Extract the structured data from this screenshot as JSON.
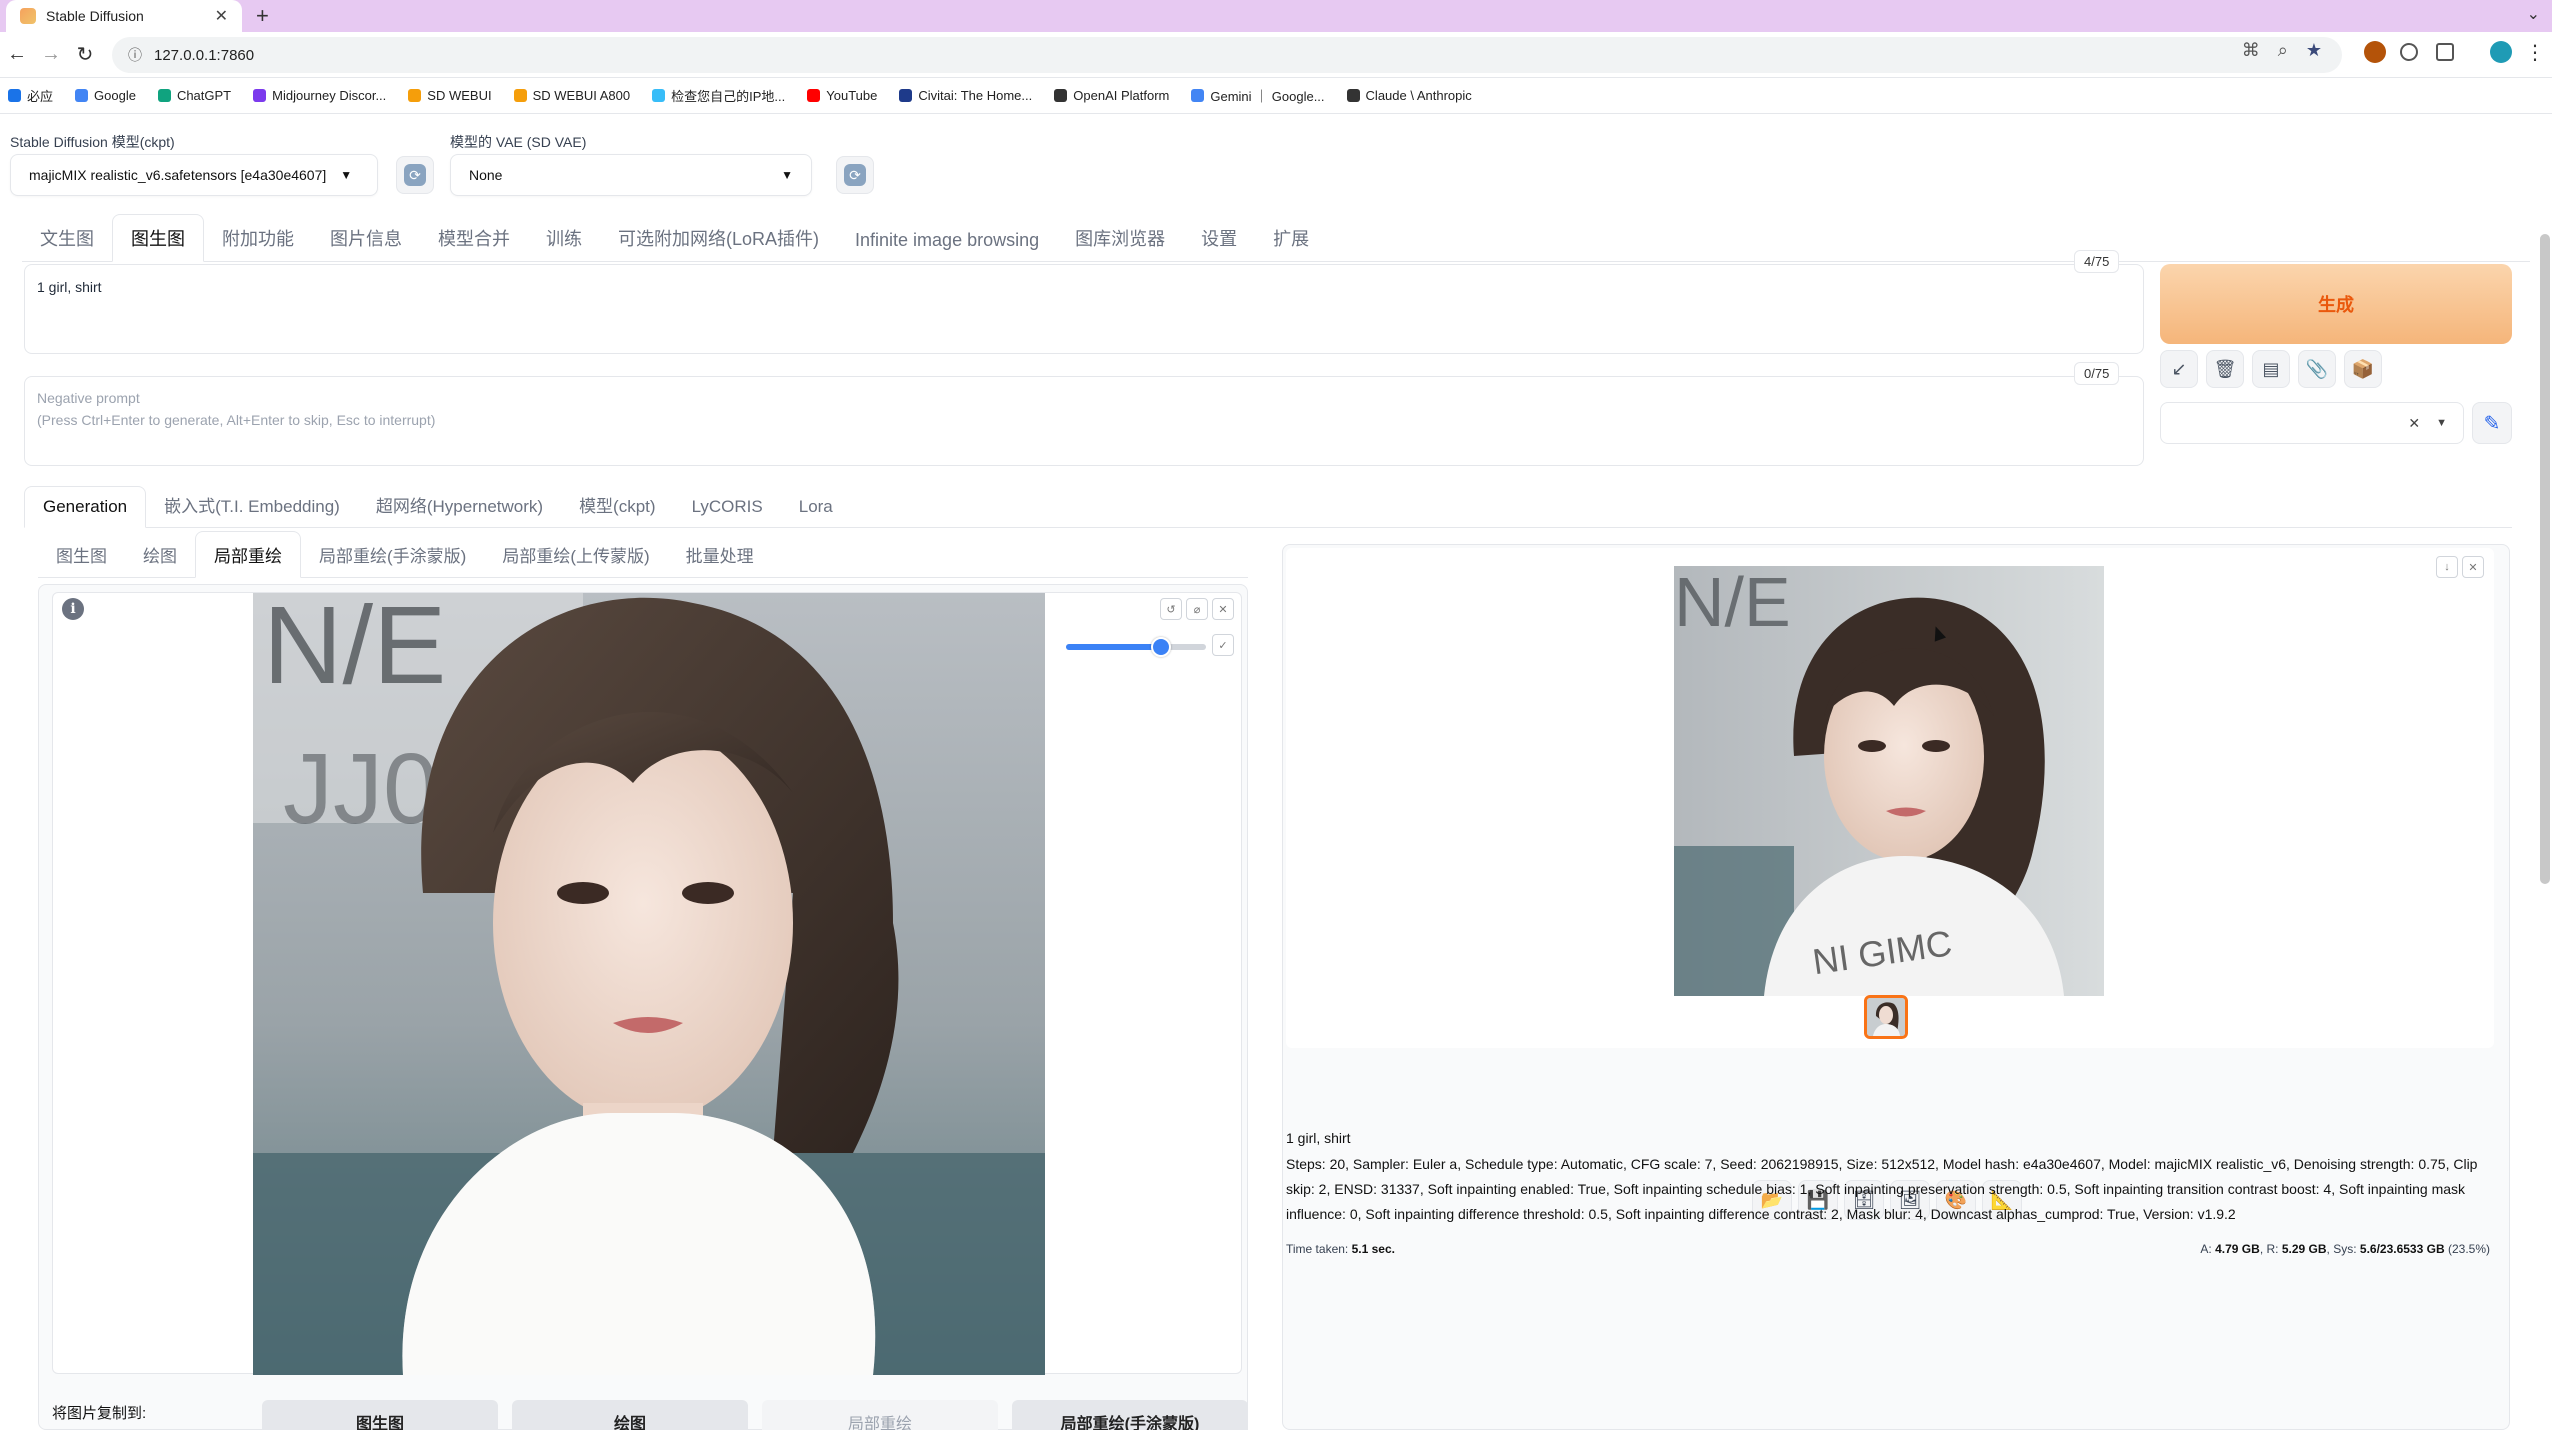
{
  "browser": {
    "tab_title": "Stable Diffusion",
    "tab_close": "✕",
    "new_tab": "+",
    "url": "127.0.0.1:7860",
    "bookmarks": [
      {
        "label": "必应",
        "color": "#1a73e8"
      },
      {
        "label": "Google",
        "color": "#4285f4"
      },
      {
        "label": "ChatGPT",
        "color": "#10a37f"
      },
      {
        "label": "Midjourney Discor...",
        "color": "#7c3aed"
      },
      {
        "label": "SD WEBUI",
        "color": "#f59e0b"
      },
      {
        "label": "SD WEBUI A800",
        "color": "#f59e0b"
      },
      {
        "label": "检查您自己的IP地...",
        "color": "#38bdf8"
      },
      {
        "label": "YouTube",
        "color": "#ff0000"
      },
      {
        "label": "Civitai: The Home...",
        "color": "#1e3a8a"
      },
      {
        "label": "OpenAI Platform",
        "color": "#333333"
      },
      {
        "label": "Gemini ｜ Google...",
        "color": "#4285f4"
      },
      {
        "label": "Claude \\ Anthropic",
        "color": "#333333"
      }
    ]
  },
  "model": {
    "ckpt_label": "Stable Diffusion 模型(ckpt)",
    "ckpt_value": "majicMIX realistic_v6.safetensors [e4a30e4607]",
    "vae_label": "模型的 VAE (SD VAE)",
    "vae_value": "None"
  },
  "main_tabs": [
    "文生图",
    "图生图",
    "附加功能",
    "图片信息",
    "模型合并",
    "训练",
    "可选附加网络(LoRA插件)",
    "Infinite image browsing",
    "图库浏览器",
    "设置",
    "扩展"
  ],
  "prompt": {
    "positive": "1 girl, shirt",
    "positive_counter": "4/75",
    "negative_placeholder_1": "Negative prompt",
    "negative_placeholder_2": "(Press Ctrl+Enter to generate, Alt+Enter to skip, Esc to interrupt)",
    "negative_counter": "0/75"
  },
  "generate_label": "生成",
  "network_tabs": [
    "Generation",
    "嵌入式(T.I. Embedding)",
    "超网络(Hypernetwork)",
    "模型(ckpt)",
    "LyCORIS",
    "Lora"
  ],
  "mode_tabs": [
    "图生图",
    "绘图",
    "局部重绘",
    "局部重绘(手涂蒙版)",
    "局部重绘(上传蒙版)",
    "批量处理"
  ],
  "brush_size_fraction": 0.68,
  "copy_to": {
    "label": "将图片复制到:",
    "buttons": [
      "图生图",
      "绘图",
      "局部重绘",
      "局部重绘(手涂蒙版)"
    ]
  },
  "output": {
    "prompt": "1 girl, shirt",
    "params": "Steps: 20, Sampler: Euler a, Schedule type: Automatic, CFG scale: 7, Seed: 2062198915, Size: 512x512, Model hash: e4a30e4607, Model: majicMIX realistic_v6, Denoising strength: 0.75, Clip skip: 2, ENSD: 31337, Soft inpainting enabled: True, Soft inpainting schedule bias: 1, Soft inpainting preservation strength: 0.5, Soft inpainting transition contrast boost: 4, Soft inpainting mask influence: 0, Soft inpainting difference threshold: 0.5, Soft inpainting difference contrast: 2, Mask blur: 4, Downcast alphas_cumprod: True, Version: v1.9.2",
    "time_label": "Time taken:",
    "time_value": "5.1 sec.",
    "mem_a_label": "A:",
    "mem_a": "4.79 GB",
    "mem_r_label": "R:",
    "mem_r": "5.29 GB",
    "mem_sys_label": "Sys:",
    "mem_sys": "5.6/23.6533 GB",
    "mem_pct": "(23.5%)"
  },
  "colors": {
    "accent_orange": "#f97316",
    "generate_bg": "#f5b57a",
    "slider_blue": "#3b82f6"
  }
}
